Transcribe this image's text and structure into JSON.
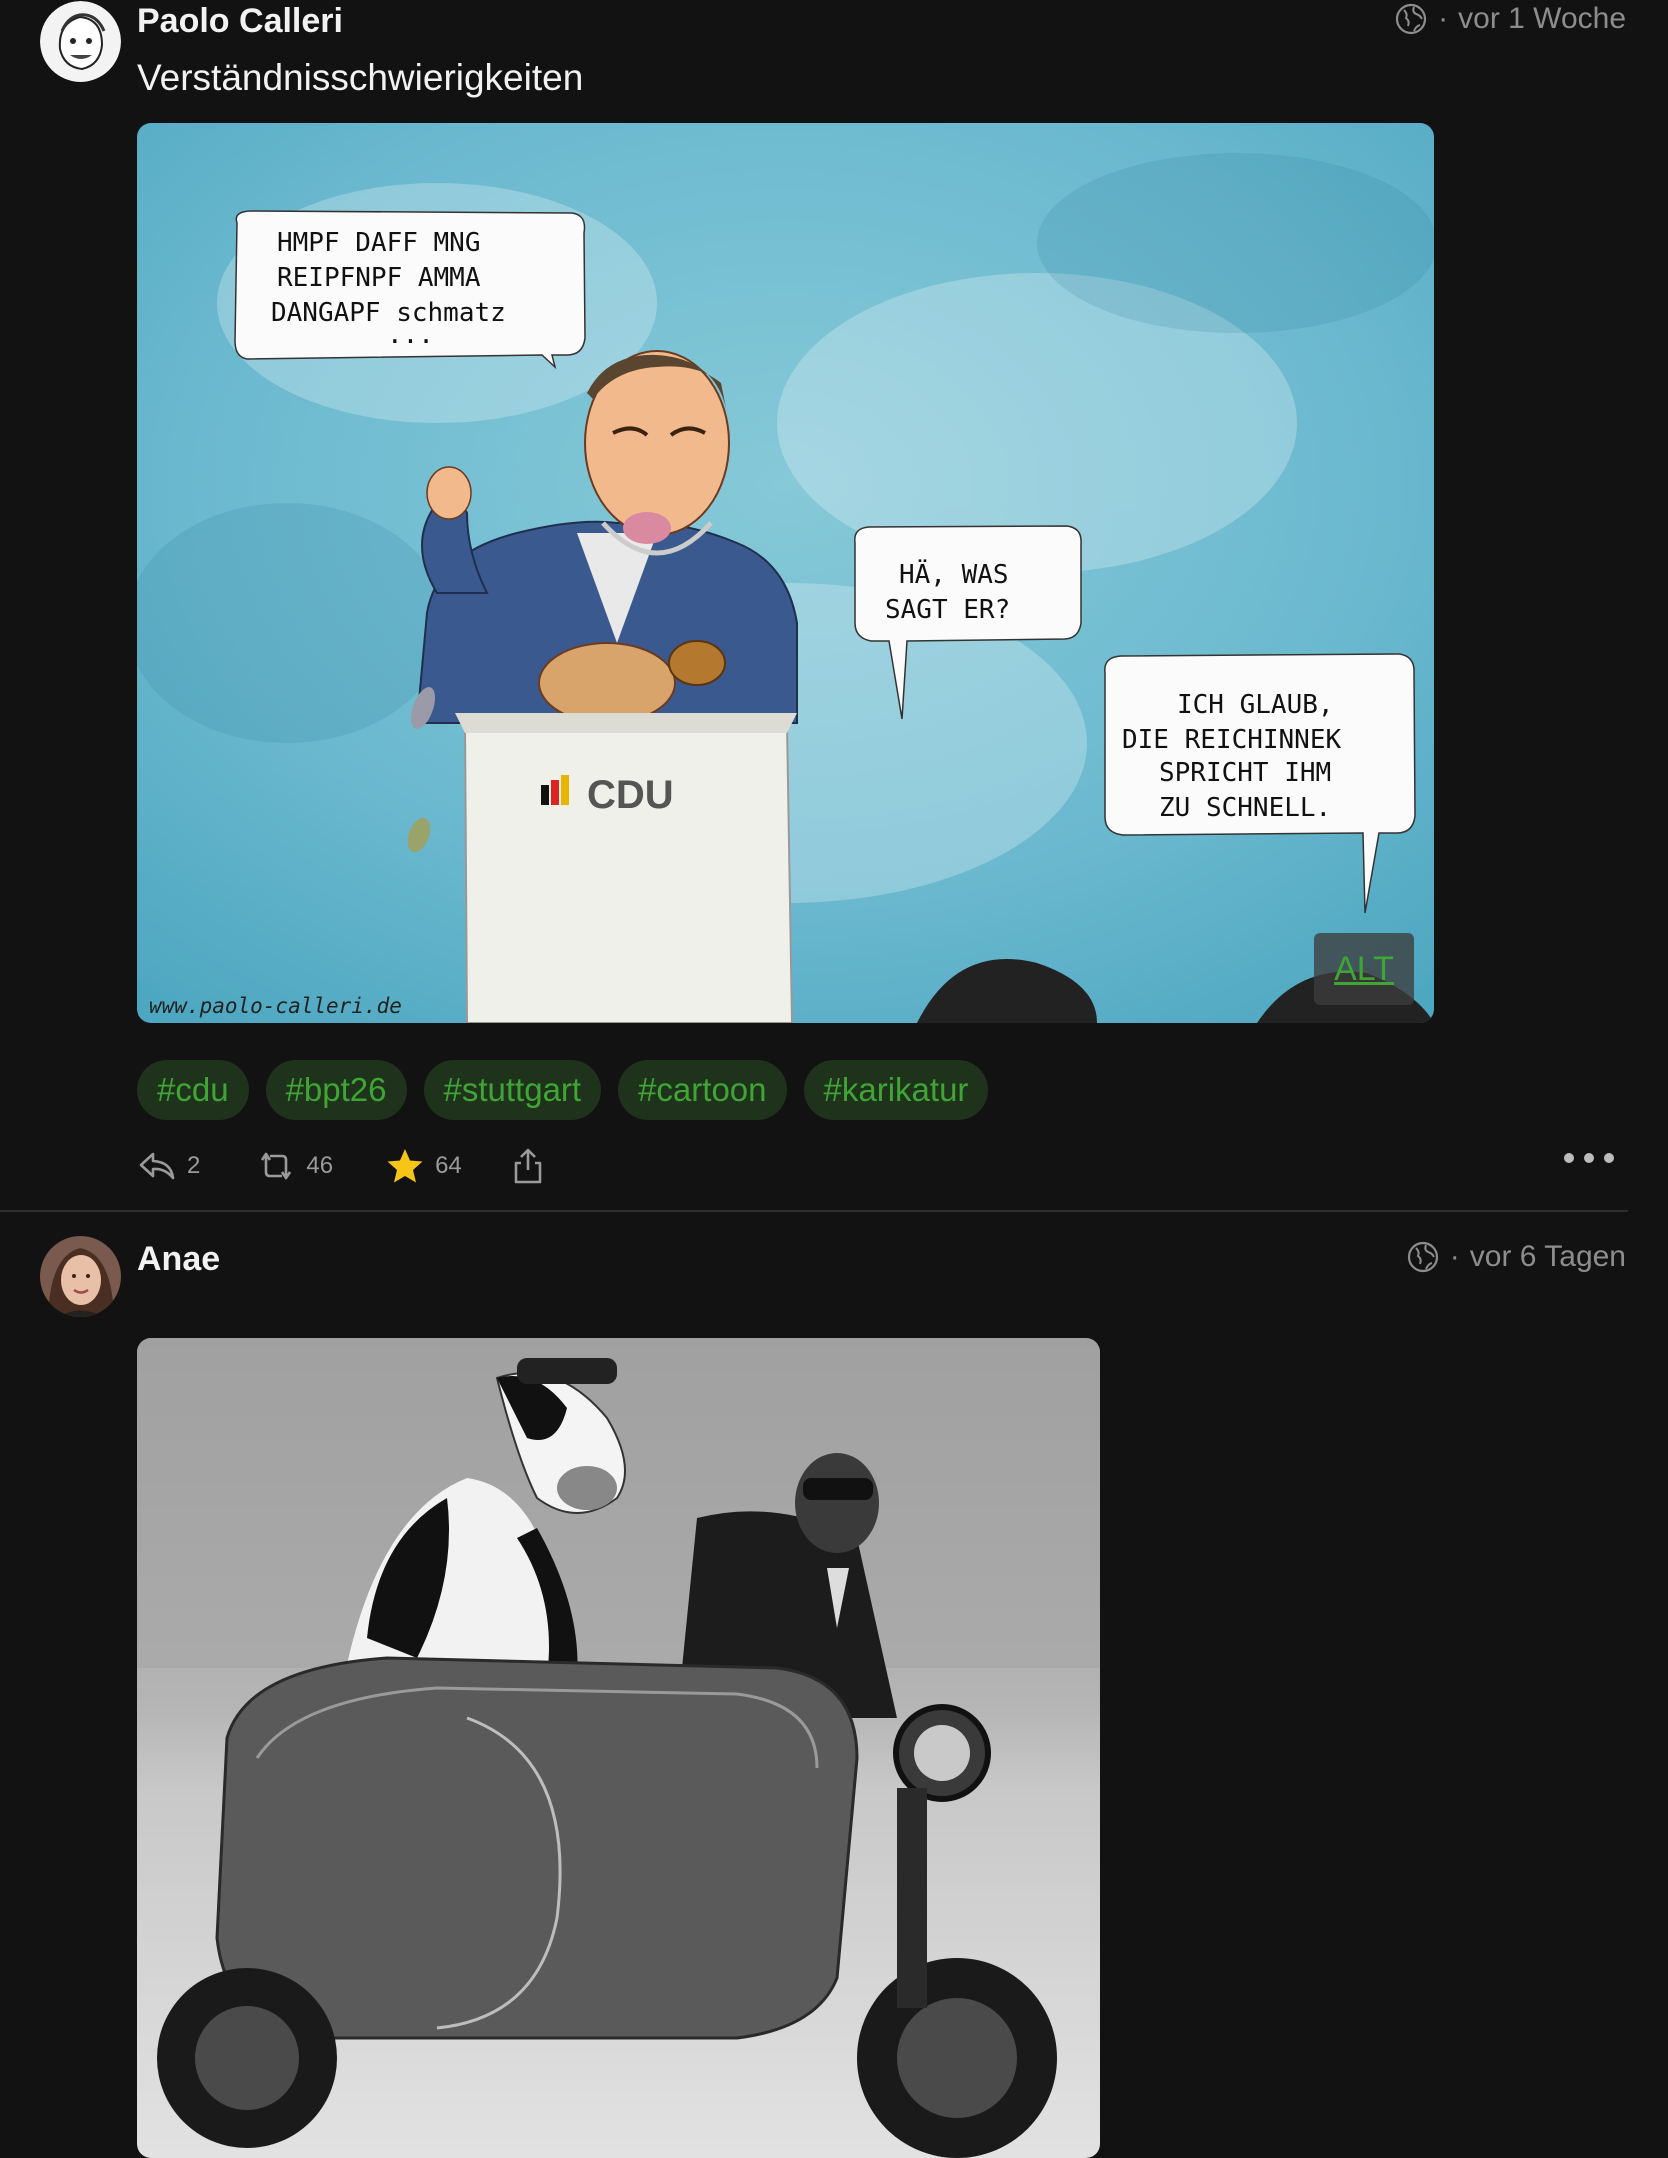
{
  "posts": [
    {
      "author": "Paolo Calleri",
      "time": "vor 1 Woche",
      "visibility_icon": "globe-icon",
      "text": "Verständnisschwierigkeiten",
      "cartoon": {
        "bubble1": [
          "HMPF DAFF MNG",
          "REIPFNPF AMMA",
          "DANGAPF schmatz"
        ],
        "bubble1_dots": "...",
        "bubble2": [
          "HÄ, WAS",
          "SAGT ER?"
        ],
        "bubble3": [
          "ICH GLAUB,",
          "DIE REICHINNEK",
          "SPRICHT IHM",
          "ZU SCHNELL."
        ],
        "podium_label": "CDU",
        "signature": "www.paolo-calleri.de"
      },
      "alt_label": "ALT",
      "tags": [
        "#cdu",
        "#bpt26",
        "#stuttgart",
        "#cartoon",
        "#karikatur"
      ],
      "actions": {
        "replies": "2",
        "boosts": "46",
        "favourites": "64"
      }
    },
    {
      "author": "Anae",
      "time": "vor 6 Tagen",
      "visibility_icon": "globe-icon"
    }
  ],
  "colors": {
    "background": "#121212",
    "accent_green": "#3fa535",
    "tag_bg": "#1f331c",
    "star": "#f5c518"
  }
}
